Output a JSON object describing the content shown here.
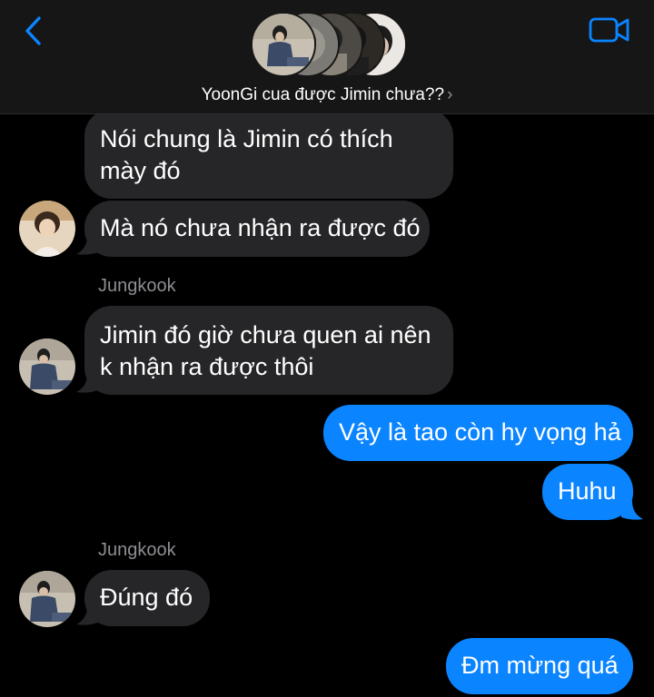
{
  "header": {
    "title": "YoonGi cua được Jimin chưa??",
    "chevron": "›",
    "back_icon": "chevron-left-icon",
    "video_icon": "video-camera-icon",
    "accent_color": "#0b84ff"
  },
  "messages": [
    {
      "text_lines": [
        "Nói chung là Jimin có thích",
        "mày đó"
      ]
    },
    {
      "text_lines": [
        "Mà nó chưa nhận ra được đó"
      ]
    },
    {
      "sender": "Jungkook",
      "text_lines": [
        "Jimin đó giờ chưa quen ai nên",
        "k nhận ra được thôi"
      ]
    },
    {
      "text_lines": [
        "Vậy là tao còn hy vọng hả"
      ]
    },
    {
      "text_lines": [
        "Huhu"
      ]
    },
    {
      "sender": "Jungkook",
      "text_lines": [
        "Đúng đó"
      ]
    },
    {
      "text_lines": [
        "Đm mừng quá"
      ]
    }
  ],
  "colors": {
    "incoming_bubble": "#262628",
    "outgoing_bubble": "#0b84ff",
    "sender_label": "#8e8e93"
  }
}
